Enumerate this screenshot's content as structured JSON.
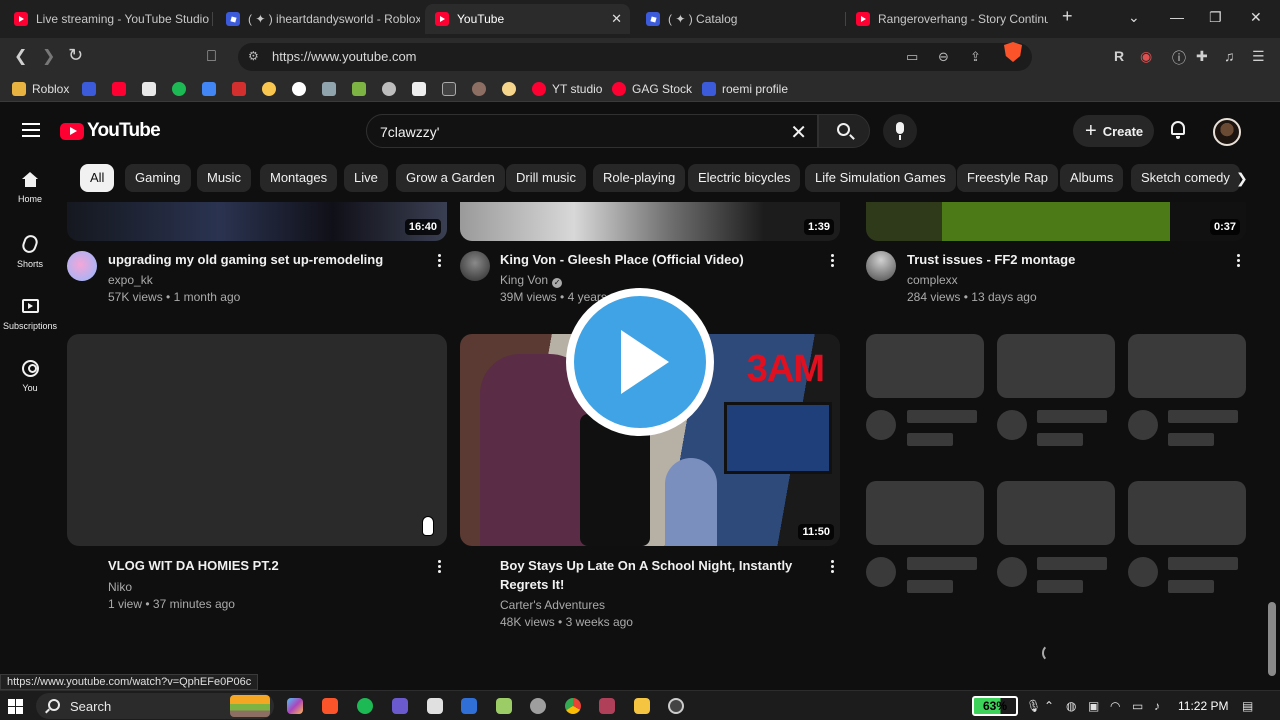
{
  "browser": {
    "tabs": [
      {
        "title": "Live streaming - YouTube Studio",
        "favicon": "youtube-icon"
      },
      {
        "title": "( ✦ ) iheartdandysworld - Roblox",
        "favicon": "roblox-icon"
      },
      {
        "title": "YouTube",
        "favicon": "youtube-icon",
        "active": true
      },
      {
        "title": "( ✦ ) Catalog",
        "favicon": "roblox-icon"
      },
      {
        "title": "Rangeroverhang - Story Continu",
        "favicon": "youtube-icon"
      }
    ],
    "tab_close_glyph": "✕",
    "new_tab_glyph": "+",
    "url": "https://www.youtube.com",
    "bookmarks": [
      {
        "label": "Roblox",
        "icon": "folder-icon",
        "color": "#e8b341"
      },
      {
        "label": "YT studio",
        "icon": "youtube-icon",
        "color": "#ff0033"
      },
      {
        "label": "GAG Stock",
        "icon": "youtube-icon",
        "color": "#ff0033"
      },
      {
        "label": "roemi profile",
        "icon": "roblox-icon",
        "color": "#3b5bdb"
      }
    ],
    "status_url": "https://www.youtube.com/watch?v=QphEFe0P06c"
  },
  "youtube": {
    "logo_text": "YouTube",
    "search_query": "7clawzzy'",
    "create_label": "Create",
    "chips": [
      "All",
      "Gaming",
      "Music",
      "Montages",
      "Live",
      "Grow a Garden",
      "Drill music",
      "Role-playing",
      "Electric bicycles",
      "Life Simulation Games",
      "Freestyle Rap",
      "Albums",
      "Sketch comedy"
    ],
    "active_chip": "All",
    "guide": [
      {
        "label": "Home",
        "icon": "home-icon"
      },
      {
        "label": "Shorts",
        "icon": "shorts-icon"
      },
      {
        "label": "Subscriptions",
        "icon": "subscriptions-icon"
      },
      {
        "label": "You",
        "icon": "you-icon"
      }
    ],
    "videos_row1": [
      {
        "title": "upgrading my old gaming set up-remodeling",
        "channel": "expo_kk",
        "views": "57K views",
        "age": "1 month ago",
        "duration": "16:40",
        "verified": false
      },
      {
        "title": "King Von - Gleesh Place (Official Video)",
        "channel": "King Von",
        "views": "39M views",
        "age": "4 years ago",
        "duration": "1:39",
        "verified": true
      },
      {
        "title": "Trust issues - FF2 montage",
        "channel": "complexx",
        "views": "284 views",
        "age": "13 days ago",
        "duration": "0:37",
        "verified": false
      }
    ],
    "videos_row2": [
      {
        "title": "VLOG WIT DA HOMIES PT.2",
        "channel": "Niko",
        "views": "1 view",
        "age": "37 minutes ago",
        "duration": ""
      },
      {
        "title_line1": "Boy Stays Up Late On A School Night, Instantly",
        "title_line2": "Regrets It!",
        "channel": "Carter's Adventures",
        "views": "48K views",
        "age": "3 weeks ago",
        "duration": "11:50",
        "thumb_text": "3AM"
      }
    ],
    "meta_sep": "•"
  },
  "taskbar": {
    "search_label": "Search",
    "battery": "63%",
    "time": "11:22 PM"
  }
}
